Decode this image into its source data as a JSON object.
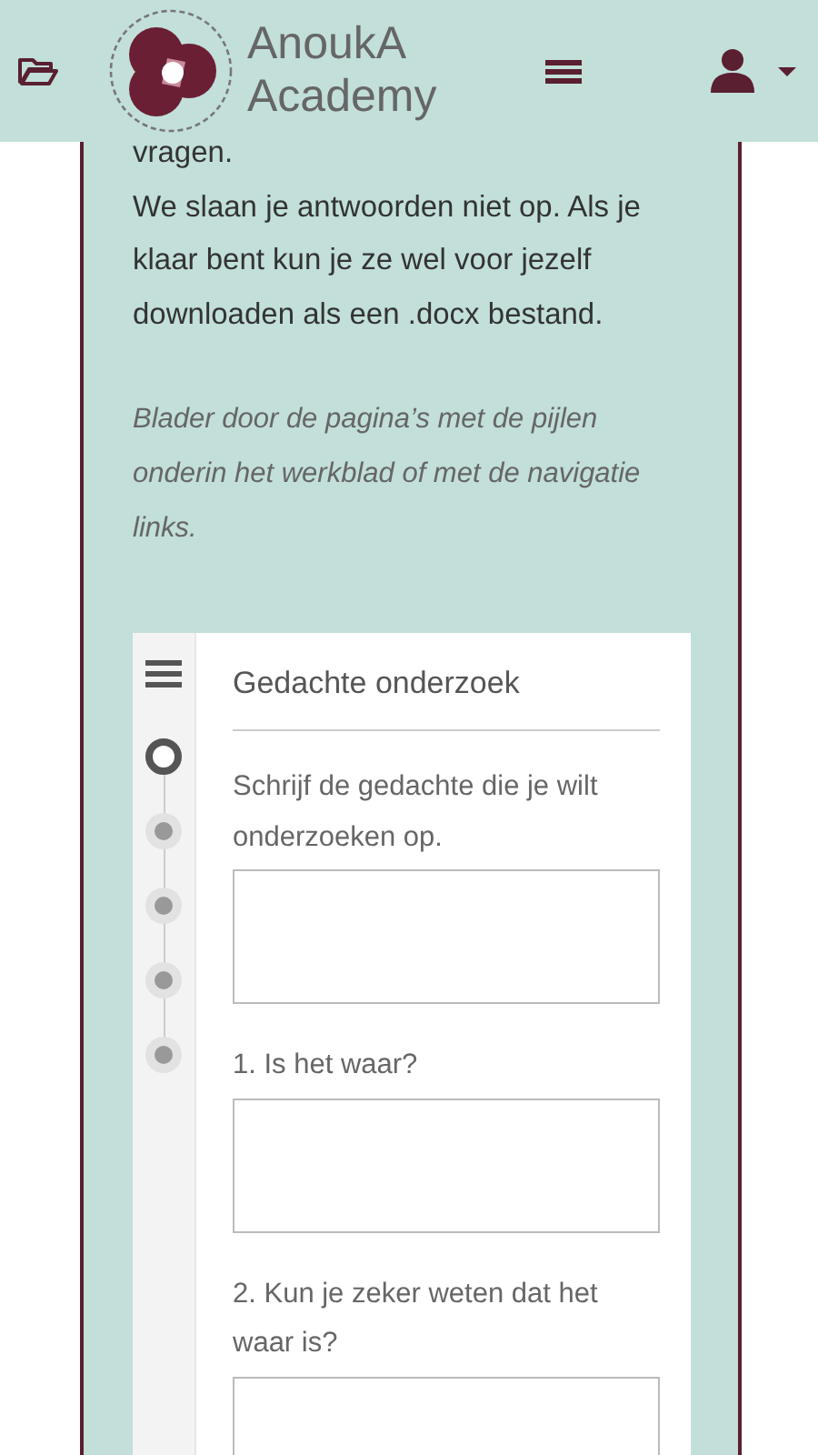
{
  "header": {
    "brand": "AnoukA Academy"
  },
  "intro": {
    "cut_text": "vragen.",
    "paragraph": "We slaan je antwoorden niet op. Als je klaar bent kun je ze wel voor jezelf downloaden als een .docx bestand.",
    "hint": "Blader door de pagina’s met de pijlen onderin het werkblad of met de navigatie links."
  },
  "worksheet": {
    "title": "Gedachte onderzoek",
    "steps": [
      {
        "selected": true
      },
      {
        "selected": false
      },
      {
        "selected": false
      },
      {
        "selected": false
      },
      {
        "selected": false
      }
    ],
    "questions": [
      {
        "label": "Schrijf de gedachte die je wilt onderzoeken op."
      },
      {
        "label": "1. Is het waar?"
      },
      {
        "label": "2. Kun je zeker weten dat het waar is?"
      }
    ]
  }
}
